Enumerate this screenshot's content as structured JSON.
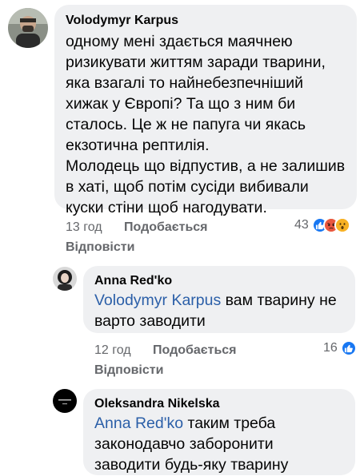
{
  "comments": [
    {
      "author": "Volodymyr Karpus",
      "lines": [
        "одному мені здається маячнею",
        "ризикувати життям заради тварини,",
        "яка взагалі то найнебезпечніший",
        "хижак у Європі? Та що з ним би",
        "сталось. Це ж не папуга чи якась",
        "екзотична рептилія.",
        "Молодець що відпустив, а не залишив",
        "в хаті, щоб потім сусіди вибивали",
        "куски стіни щоб нагодувати."
      ],
      "time": "13 год",
      "like_label": "Подобається",
      "reply_label": "Відповісти",
      "reaction_count": "43",
      "reactions": [
        "like-icon",
        "angry-icon",
        "wow-icon"
      ]
    },
    {
      "author": "Anna Red'ko",
      "mention": "Volodymyr Karpus",
      "line1_rest": " вам тварину не",
      "line2": "варто заводити",
      "time": "12 год",
      "like_label": "Подобається",
      "reply_label": "Відповісти",
      "reaction_count": "16",
      "reactions": [
        "like-icon"
      ]
    },
    {
      "author": "Oleksandra Nikelska",
      "mention": "Anna Red'ko",
      "line1_rest": " таким треба",
      "line2": "законодавчо заборонити",
      "line3": "заводити будь-яку тварину"
    }
  ],
  "colors": {
    "bubble": "#eff0f2",
    "mention": "#2b5fa8",
    "meta": "#65676b",
    "like_reaction": "#1877f2"
  }
}
